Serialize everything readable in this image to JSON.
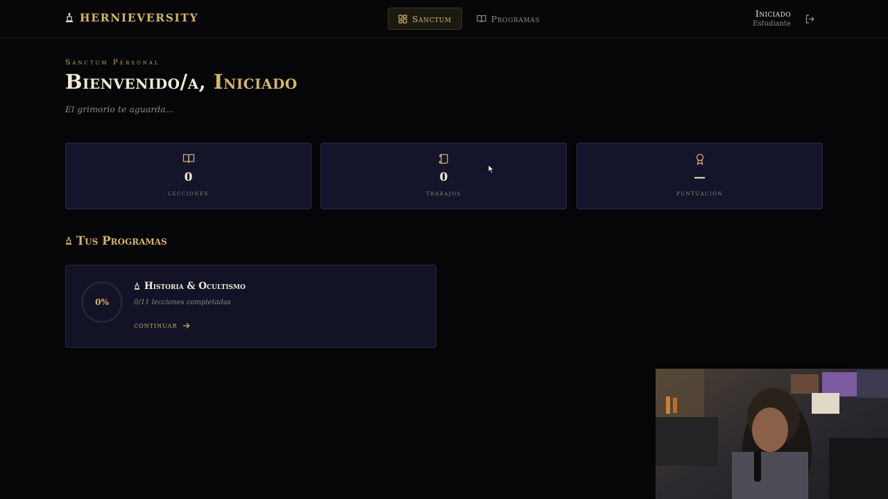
{
  "brand": {
    "name": "HERNIEVERSITY",
    "icon": "candle-icon"
  },
  "nav": [
    {
      "label": "Sanctum",
      "icon": "dashboard-grid-icon",
      "active": true
    },
    {
      "label": "Programas",
      "icon": "open-book-icon",
      "active": false
    }
  ],
  "user": {
    "name": "Iniciado",
    "role": "Estudiante",
    "logout_icon": "logout-icon"
  },
  "hero": {
    "kicker": "Sanctum Personal",
    "greeting": "Bienvenido/a,",
    "name": "Iniciado",
    "subtitle": "El grimorio te aguarda..."
  },
  "stats": [
    {
      "icon": "open-book-icon",
      "value": "0",
      "label": "lecciones"
    },
    {
      "icon": "scroll-icon",
      "value": "0",
      "label": "trabajos"
    },
    {
      "icon": "award-icon",
      "value": "—",
      "label": "puntuación"
    }
  ],
  "programs_section": {
    "title": "Tus Programas",
    "icon": "candle-icon"
  },
  "programs": [
    {
      "title": "Historia & Ocultismo",
      "icon": "candle-icon",
      "percent": "0%",
      "progress_text": "0/11 lecciones completadas",
      "action": "continuar",
      "action_icon": "arrow-right-icon"
    }
  ],
  "colors": {
    "accent": "#d4b56a",
    "background": "#060609",
    "card": "#14142a",
    "card_border": "#2b2b3f"
  }
}
